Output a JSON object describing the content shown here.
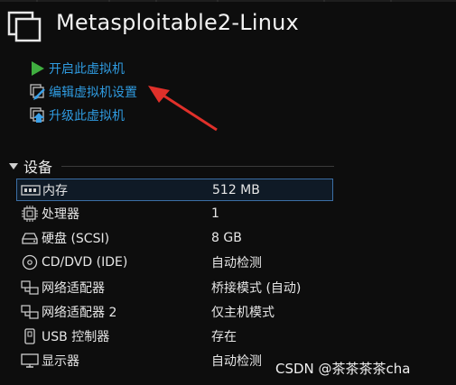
{
  "window": {
    "title": "Metasploitable2-Linux"
  },
  "actions": [
    {
      "label": "开启此虚拟机",
      "icon": "play-icon"
    },
    {
      "label": "编辑虚拟机设置",
      "icon": "edit-settings-icon"
    },
    {
      "label": "升级此虚拟机",
      "icon": "upgrade-icon"
    }
  ],
  "devices_section": {
    "title": "设备",
    "rows": [
      {
        "name": "内存",
        "value": "512 MB",
        "icon": "memory-icon"
      },
      {
        "name": "处理器",
        "value": "1",
        "icon": "cpu-icon"
      },
      {
        "name": "硬盘 (SCSI)",
        "value": "8 GB",
        "icon": "hard-disk-icon"
      },
      {
        "name": "CD/DVD (IDE)",
        "value": "自动检测",
        "icon": "cd-dvd-icon"
      },
      {
        "name": "网络适配器",
        "value": "桥接模式 (自动)",
        "icon": "network-adapter-icon"
      },
      {
        "name": "网络适配器 2",
        "value": "仅主机模式",
        "icon": "network-adapter-icon"
      },
      {
        "name": "USB 控制器",
        "value": "存在",
        "icon": "usb-icon"
      },
      {
        "name": "显示器",
        "value": "自动检测",
        "icon": "display-icon"
      }
    ],
    "selected_index": 0
  },
  "watermark": "CSDN @茶茶茶茶cha",
  "colors": {
    "link": "#2f9be0",
    "play": "#3fae3f",
    "annotation_arrow": "#e0302a",
    "selection_border": "#3b6ea5"
  }
}
